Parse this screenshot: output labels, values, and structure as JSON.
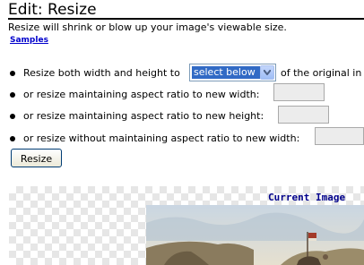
{
  "page": {
    "title": "Edit: Resize",
    "description": "Resize will shrink or blow up your image's viewable size.",
    "samples_link": "Samples"
  },
  "options": {
    "opt1_label": "Resize both width and height to",
    "opt1_select_value": "select below",
    "opt1_suffix": "of the original in",
    "opt2_label": "or resize maintaining aspect ratio to new width:",
    "opt3_label": "or resize maintaining aspect ratio to new height:",
    "opt4_label": "or resize without maintaining aspect ratio to new width:",
    "opt2_value": "",
    "opt3_value": "",
    "opt4_value": ""
  },
  "actions": {
    "resize_label": "Resize"
  },
  "preview": {
    "current_image_label": "Current Image"
  },
  "colors": {
    "link": "#0000cc",
    "select_highlight": "#316ac5",
    "current_label": "#00008b"
  }
}
